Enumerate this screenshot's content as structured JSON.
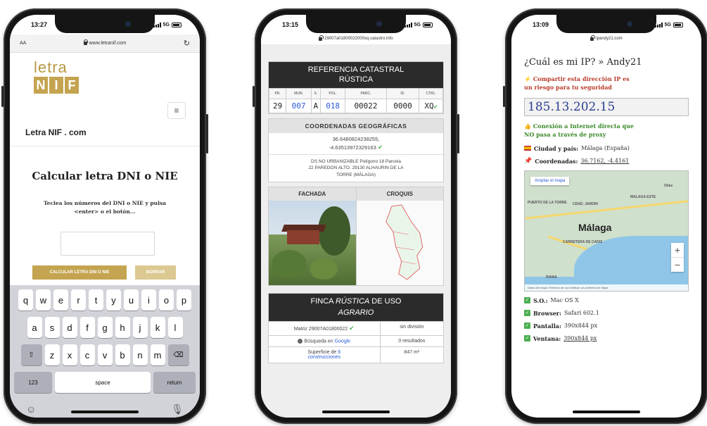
{
  "phone1": {
    "status_time": "13:27",
    "network": "5G",
    "url_left": "AA",
    "url": "www.letranif.com",
    "reload_icon": "reload-icon",
    "logo_top": "letra",
    "logo_letters": [
      "N",
      "I",
      "F"
    ],
    "site_name": "Letra NIF . com",
    "heading": "Calcular letra DNI o NIE",
    "desc_line1": "Teclea los números del DNI o NIE y pulsa",
    "desc_line2": "<enter> o el botón...",
    "calc_button": "CALCULAR LETRA DNI O NIE",
    "clear_button": "BORRAR",
    "keyboard": {
      "row1": [
        "q",
        "w",
        "e",
        "r",
        "t",
        "y",
        "u",
        "i",
        "o",
        "p"
      ],
      "row2": [
        "a",
        "s",
        "d",
        "f",
        "g",
        "h",
        "j",
        "k",
        "l"
      ],
      "row3": [
        "z",
        "x",
        "c",
        "v",
        "b",
        "n",
        "m"
      ],
      "shift": "⇧",
      "backspace": "⌫",
      "numbers": "123",
      "space": "space",
      "return": "return",
      "emoji": "☺",
      "mic": "🎙"
    }
  },
  "phone2": {
    "status_time": "13:15",
    "network": "5G",
    "url": "29007a01800022000xq.catastro.info",
    "title_line1": "REFERENCIA CATASTRAL",
    "title_line2": "RÚSTICA",
    "ref_headers": [
      "PR.",
      "MUN.",
      "S.",
      "POL.",
      "PARC.",
      "ID.",
      "CTRL."
    ],
    "ref_values": [
      "29",
      "007",
      "A",
      "018",
      "00022",
      "0000",
      "XQ"
    ],
    "coords_heading": "COORDENADAS GEOGRÁFICAS",
    "coords_line1": "36.6480824238255,",
    "coords_line2": "-4.63513972329163",
    "address_line1": "DS NO URBANIZABLE Polígono 18 Parcela",
    "address_line2": "22 PAREDON ALTO. 29130 ALHAURIN DE LA",
    "address_line3": "TORRE (MÁLAGA)",
    "facade_label": "FACHADA",
    "sketch_label": "CROQUIS",
    "finca_pre": "FINCA ",
    "finca_em": "RÚSTICA",
    "finca_post": " DE USO",
    "finca_line2": "AGRARIO",
    "matrix": "Matriz 29007A01800022",
    "division": "sin división",
    "search_pre": "Búsqueda en ",
    "search_link": "Google",
    "results": "0 resultados",
    "surface_pre": "Superficie de ",
    "surface_link": "6",
    "surface_line2": "construcciones",
    "surface_value": "847 m²"
  },
  "phone3": {
    "status_time": "13:09",
    "network": "5G",
    "url": "ipandy21.com",
    "title": "¿Cuál es mi IP? » Andy21",
    "warn_line1": "⚡ Compartir esta dirección IP es",
    "warn_line2": "un riesgo para tu seguridad",
    "ip": "185.13.202.15",
    "direct_line1": "👍 Conexión a Internet directa que",
    "direct_line2": "NO pasa a través de proxy",
    "city_label": "Ciudad y país:",
    "city_value": "Málaga (España)",
    "coords_label": "Coordenadas:",
    "coords_value": "36.7162, -4.4161",
    "map_button": "Ampliar el mapa",
    "map_city": "Málaga",
    "map_labels": [
      "PUERTO DE LA TORRE",
      "CDAD. JARDIN",
      "MALAGA ESTE",
      "CARRETERA DE CADIZ",
      "Olías",
      "RIANA"
    ],
    "map_zoom_in": "+",
    "map_zoom_out": "−",
    "map_footer": "Datos del mapa   Términos de uso   Notificar un problema de Maps",
    "os_label": "S.O.:",
    "os_value": "Mac OS X",
    "browser_label": "Browser:",
    "browser_value": "Safari 602.1",
    "screen_label": "Pantalla:",
    "screen_value": "390x844 px",
    "window_label": "Ventana:",
    "window_value": "390x844 px"
  }
}
